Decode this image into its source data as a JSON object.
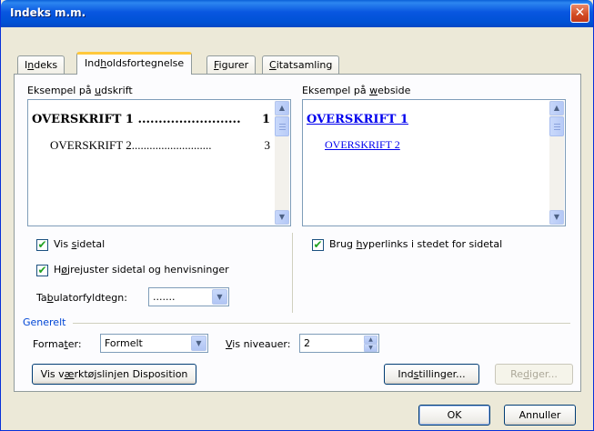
{
  "window": {
    "title": "Indeks m.m.",
    "close_glyph": "✕"
  },
  "tabs": [
    {
      "label_pre": "I",
      "label_ul": "n",
      "label_post": "deks",
      "active": false
    },
    {
      "label_pre": "Ind",
      "label_ul": "h",
      "label_post": "oldsfortegnelse",
      "active": true
    },
    {
      "label_pre": "",
      "label_ul": "F",
      "label_post": "igurer",
      "active": false
    },
    {
      "label_pre": "",
      "label_ul": "C",
      "label_post": "itatsamling",
      "active": false
    }
  ],
  "print_preview": {
    "label_pre": "Eksempel på ",
    "label_ul": "u",
    "label_post": "dskrift",
    "line1": "OVERSKRIFT 1 .........................",
    "line1_page": "1",
    "line2": "OVERSKRIFT 2...........................",
    "line2_page": "3"
  },
  "web_preview": {
    "label_pre": "Eksempel på ",
    "label_ul": "w",
    "label_post": "ebside",
    "line1": "OVERSKRIFT 1",
    "line2": "OVERSKRIFT 2"
  },
  "options": {
    "show_page_numbers": {
      "pre": "Vis ",
      "ul": "s",
      "post": "idetal",
      "checked": true
    },
    "right_align": {
      "pre": "H",
      "ul": "ø",
      "post": "jrejuster sidetal og henvisninger",
      "checked": true
    },
    "use_hyperlinks": {
      "pre": "Brug ",
      "ul": "h",
      "post": "yperlinks i stedet for sidetal",
      "checked": true
    },
    "tab_leader": {
      "label_pre": "Ta",
      "label_ul": "b",
      "label_post": "ulatorfyldtegn:",
      "value": "......."
    }
  },
  "general": {
    "section_label": "Generelt",
    "formats": {
      "label_pre": "Forma",
      "label_ul": "t",
      "label_post": "er:",
      "value": "Formelt"
    },
    "levels": {
      "label_pre": "",
      "label_ul": "V",
      "label_post": "is niveauer:",
      "value": "2"
    }
  },
  "buttons": {
    "toolbar": {
      "pre": "Vis v",
      "ul": "æ",
      "post": "rktøjslinjen Disposition"
    },
    "settings": {
      "pre": "Ind",
      "ul": "s",
      "post": "tillinger..."
    },
    "edit": {
      "pre": "Re",
      "ul": "d",
      "post": "iger..."
    },
    "ok": "OK",
    "cancel": "Annuller"
  },
  "icons": {
    "check": "✔",
    "arrow_up": "▲",
    "arrow_down": "▼"
  },
  "colors": {
    "title_bar": "#0054e3",
    "tab_highlight": "#ffc83c",
    "link": "#0000ee",
    "section_label": "#0046d5"
  }
}
